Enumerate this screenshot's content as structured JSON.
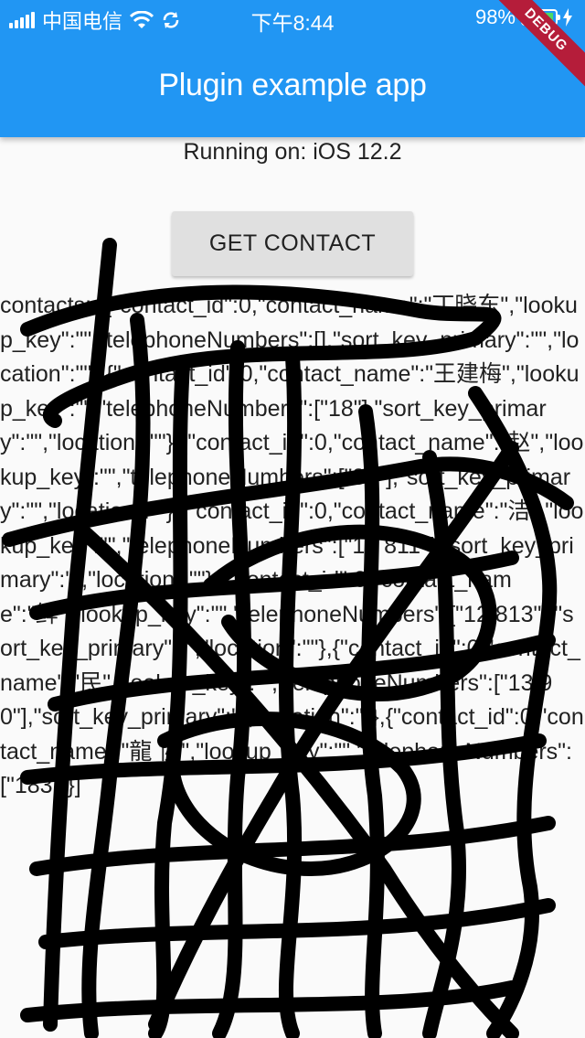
{
  "status_bar": {
    "carrier": "中国电信",
    "time": "下午8:44",
    "battery_percent": "98%",
    "battery_level": 0.98,
    "icons": [
      "signal-icon",
      "wifi-icon",
      "sync-icon",
      "battery-icon",
      "charging-icon"
    ]
  },
  "app_bar": {
    "title": "Plugin example app",
    "debug_banner": "DEBUG",
    "background": "#2196f3"
  },
  "main": {
    "running_on": "Running on: iOS 12.2",
    "get_contact_button": "GET CONTACT",
    "contacts_text": "contacts: [{\"contact_id\":0,\"contact_name\":\"丁晓东\",\"lookup_key\":\"\",\"telephoneNumbers\":[],\"sort_key_primary\":\"\",\"location\":\"\"},{\"contact_id\":0,\"contact_name\":\"王建梅\",\"lookup_key\":\"\",\"telephoneNumbers\":[\"18\"],\"sort_key_primary\":\"\",\"location\":\"\"},{\"contact_id\":0,\"contact_name\":\"赵\",\"lookup_key\":\"\",\"telephoneNumbers\":[\"80\"],\"sort_key_primary\":\"\",\"location\":\"\"},{\"contact_id\":0,\"contact_name\":\"洁\",\"lookup_key\":\"\",\"telephoneNumbers\":[\"13 811\"],\"sort_key_primary\":\"\",\"location\":\"\"},{\"contact_id\":0,\"contact_name\":\"鲜\",\"lookup_key\":\"\",\"telephoneNumbers\":[\"12 813\"],\"sort_key_primary\":\"\",\"location\":\"\"},{\"contact_id\":0,\"contact_name\":\"民\",\"lookup_key\":\"\",\"telephoneNumbers\":[\"13 90\"],\"sort_key_primary\":\"\",\"location\":\"\"},{\"contact_id\":0,\"contact_name\":\"龍 协\",\"lookup_key\":\"\",\"telephoneNumbers\":[\"183\"]}]"
  }
}
